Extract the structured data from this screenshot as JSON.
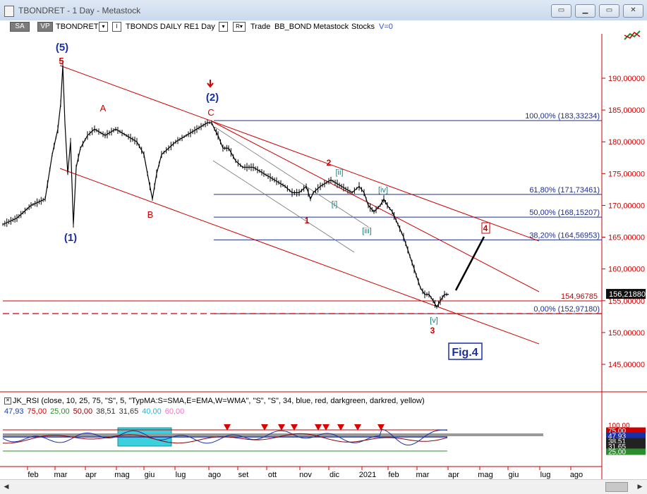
{
  "window": {
    "title": "TBONDRET - 1 Day - Metastock",
    "buttons": [
      "minimize",
      "restore",
      "maximize",
      "close"
    ]
  },
  "toolbar": {
    "sa": "SA",
    "vp": "VP",
    "symbol": "TBONDRET",
    "sym_dd": "▾",
    "i_label": "I",
    "security_name": "TBONDS DAILY RE",
    "period": "1 Day",
    "period_dd": "▾",
    "r_label": "R▾",
    "trade": "Trade",
    "bb_bond": "BB_BOND",
    "metastock": "Metastock",
    "stocks": "Stocks",
    "v": "V=0"
  },
  "chart_data": {
    "type": "line",
    "price_axis_labels": [
      "190,00000",
      "185,00000",
      "180,00000",
      "175,00000",
      "170,00000",
      "165,00000",
      "160,00000",
      "155,00000",
      "150,00000",
      "145,00000"
    ],
    "ylim": [
      141,
      199
    ],
    "fib_levels": [
      {
        "label": "100,00% (183,33234)",
        "value": 183.33
      },
      {
        "label": "61,80% (171,73461)",
        "value": 171.73
      },
      {
        "label": "50,00% (168,15207)",
        "value": 168.15
      },
      {
        "label": "38,20% (164,56953)",
        "value": 164.57
      },
      {
        "label": "0,00% (152,97180)",
        "value": 152.97
      }
    ],
    "support_value": "154,96785",
    "last_price": "156,21880",
    "months": [
      "feb",
      "mar",
      "apr",
      "mag",
      "giu",
      "lug",
      "ago",
      "set",
      "ott",
      "nov",
      "dic",
      "2021",
      "feb",
      "mar",
      "apr",
      "mag",
      "giu",
      "lug",
      "ago"
    ],
    "wave_labels": {
      "w5": "(5)",
      "w5b": "5",
      "w1": "(1)",
      "wA": "A",
      "wB": "B",
      "wC": "C",
      "w2": "(2)",
      "i1": "1",
      "i2": "2",
      "ii": "[ii]",
      "i_": "[i]",
      "iii": "[iii]",
      "iv": "[iv]",
      "v": "[v]",
      "i3": "3",
      "i4": "4"
    },
    "fig_label": "Fig.4",
    "series": [
      {
        "name": "TBONDRET",
        "values": [
          [
            0,
            167
          ],
          [
            20,
            168
          ],
          [
            40,
            170
          ],
          [
            60,
            171
          ],
          [
            70,
            178
          ],
          [
            78,
            182
          ],
          [
            82,
            186
          ],
          [
            85,
            192
          ],
          [
            88,
            183
          ],
          [
            92,
            175
          ],
          [
            96,
            180
          ],
          [
            100,
            167
          ],
          [
            104,
            176
          ],
          [
            110,
            179
          ],
          [
            120,
            181
          ],
          [
            130,
            182
          ],
          [
            145,
            181
          ],
          [
            160,
            182
          ],
          [
            175,
            181
          ],
          [
            190,
            180
          ],
          [
            200,
            178
          ],
          [
            205,
            175
          ],
          [
            212,
            171
          ],
          [
            218,
            175
          ],
          [
            225,
            178
          ],
          [
            235,
            179
          ],
          [
            245,
            180
          ],
          [
            260,
            181
          ],
          [
            275,
            182
          ],
          [
            290,
            183
          ],
          [
            296,
            183
          ],
          [
            300,
            182
          ],
          [
            305,
            181
          ],
          [
            312,
            179
          ],
          [
            320,
            179
          ],
          [
            330,
            177
          ],
          [
            340,
            176
          ],
          [
            355,
            176
          ],
          [
            370,
            175
          ],
          [
            385,
            174
          ],
          [
            400,
            173
          ],
          [
            410,
            172
          ],
          [
            420,
            172
          ],
          [
            430,
            173
          ],
          [
            436,
            171
          ],
          [
            440,
            172
          ],
          [
            450,
            173
          ],
          [
            465,
            174
          ],
          [
            480,
            173
          ],
          [
            495,
            172
          ],
          [
            505,
            173
          ],
          [
            512,
            172
          ],
          [
            518,
            170
          ],
          [
            526,
            169
          ],
          [
            535,
            170
          ],
          [
            540,
            171
          ],
          [
            545,
            170
          ],
          [
            552,
            169
          ],
          [
            560,
            167
          ],
          [
            568,
            165
          ],
          [
            574,
            163
          ],
          [
            580,
            161
          ],
          [
            586,
            159
          ],
          [
            592,
            157
          ],
          [
            598,
            156
          ],
          [
            604,
            156
          ],
          [
            610,
            155
          ],
          [
            615,
            154
          ],
          [
            620,
            155
          ],
          [
            626,
            156
          ],
          [
            632,
            156
          ]
        ]
      }
    ]
  },
  "indicator": {
    "header": "JK_RSI  (close, 10, 25, 75, \"S\", 5, \"TypMA:S=SMA,E=EMA,W=WMA\", \"S\", \"S\", 34, blue, red, darkgreen, darkred, yellow)",
    "values": [
      {
        "text": "47,93",
        "color": "#1f3f9f"
      },
      {
        "text": "75,00",
        "color": "#cc0000"
      },
      {
        "text": "25,00",
        "color": "#2a8f2a"
      },
      {
        "text": "50,00",
        "color": "#8b0000"
      },
      {
        "text": "38,51",
        "color": "#333333"
      },
      {
        "text": "31,65",
        "color": "#333333"
      },
      {
        "text": "40,00",
        "color": "#1fb5e0"
      },
      {
        "text": "60,00",
        "color": "#e07ac0"
      }
    ],
    "axis_labels": [
      "100,00",
      "75,00",
      "47,93",
      "38,51",
      "31,65",
      "25,00"
    ]
  },
  "colors": {
    "channel": "#cc0000",
    "fib": "#1f2f8f",
    "price": "#000000",
    "wave_blue": "#1a2fa6",
    "wave_red": "#cc0000",
    "wave_teal": "#1f7f7f"
  }
}
